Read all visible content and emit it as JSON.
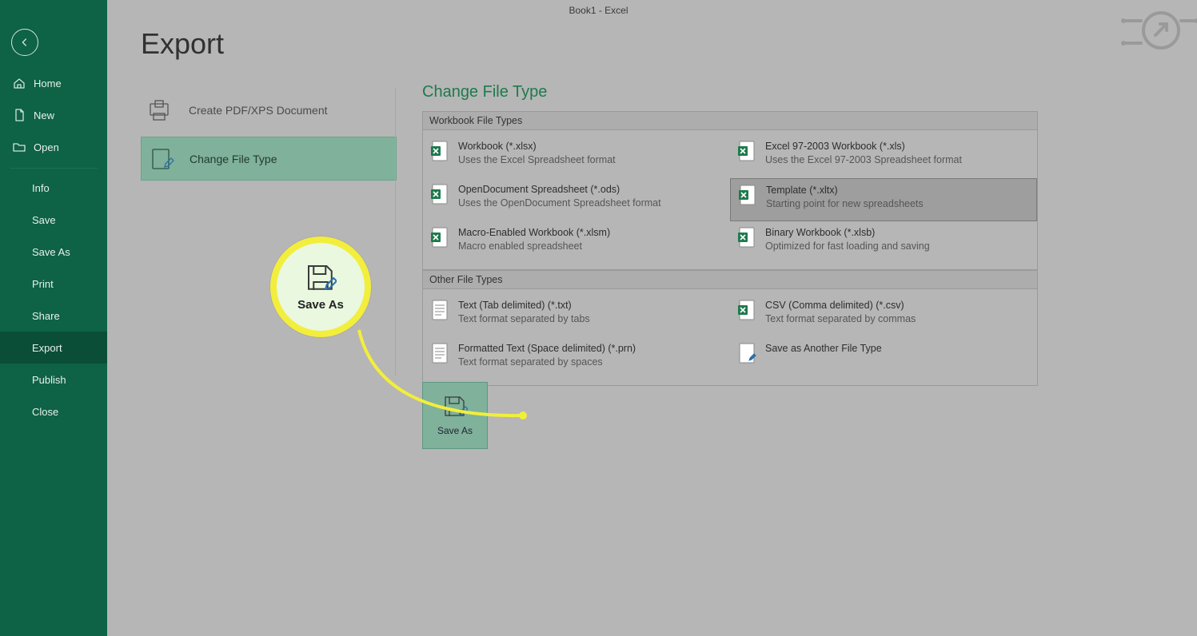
{
  "titlebar": "Book1  -  Excel",
  "page_title": "Export",
  "sidebar": {
    "top": [
      {
        "label": "Home",
        "icon": "home"
      },
      {
        "label": "New",
        "icon": "document"
      },
      {
        "label": "Open",
        "icon": "folder"
      }
    ],
    "mid": [
      {
        "label": "Info"
      },
      {
        "label": "Save"
      },
      {
        "label": "Save As"
      },
      {
        "label": "Print"
      },
      {
        "label": "Share"
      },
      {
        "label": "Export",
        "selected": true
      },
      {
        "label": "Publish"
      },
      {
        "label": "Close"
      }
    ]
  },
  "export_options": [
    {
      "label": "Create PDF/XPS Document",
      "selected": false
    },
    {
      "label": "Change File Type",
      "selected": true
    }
  ],
  "right": {
    "title": "Change File Type",
    "group1": {
      "header": "Workbook File Types",
      "items": [
        {
          "t1": "Workbook (*.xlsx)",
          "t2": "Uses the Excel Spreadsheet format",
          "icon": "xlsx"
        },
        {
          "t1": "Excel 97-2003 Workbook (*.xls)",
          "t2": "Uses the Excel 97-2003 Spreadsheet format",
          "icon": "xls"
        },
        {
          "t1": "OpenDocument Spreadsheet (*.ods)",
          "t2": "Uses the OpenDocument Spreadsheet format",
          "icon": "ods"
        },
        {
          "t1": "Template (*.xltx)",
          "t2": "Starting point for new spreadsheets",
          "icon": "xltx",
          "selected": true
        },
        {
          "t1": "Macro-Enabled Workbook (*.xlsm)",
          "t2": "Macro enabled spreadsheet",
          "icon": "xlsm"
        },
        {
          "t1": "Binary Workbook (*.xlsb)",
          "t2": "Optimized for fast loading and saving",
          "icon": "xlsb"
        }
      ]
    },
    "group2": {
      "header": "Other File Types",
      "items": [
        {
          "t1": "Text (Tab delimited) (*.txt)",
          "t2": "Text format separated by tabs",
          "icon": "txt"
        },
        {
          "t1": "CSV (Comma delimited) (*.csv)",
          "t2": "Text format separated by commas",
          "icon": "csv"
        },
        {
          "t1": "Formatted Text (Space delimited) (*.prn)",
          "t2": "Text format separated by spaces",
          "icon": "prn"
        },
        {
          "t1": "Save as Another File Type",
          "t2": "",
          "icon": "other"
        }
      ]
    }
  },
  "saveas_label": "Save As",
  "highlight_label": "Save As"
}
